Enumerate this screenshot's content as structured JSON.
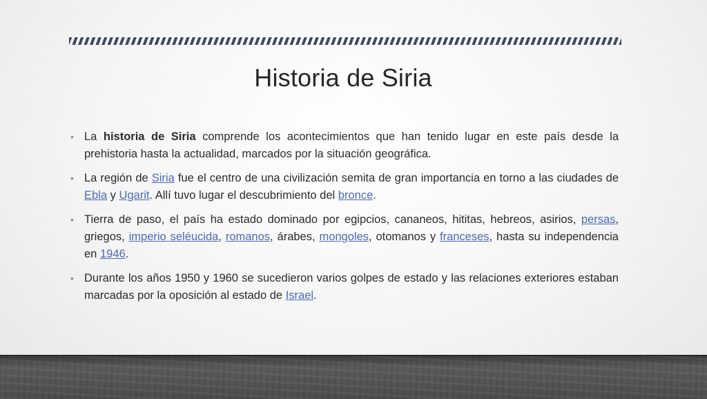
{
  "title": "Historia de Siria",
  "bullets": [
    {
      "t1": "La ",
      "b1": "historia de Siria",
      "t2": " comprende los acontecimientos que han tenido lugar en este país desde la prehistoria hasta la actualidad, marcados por la situación geográfica."
    },
    {
      "t1": "La región de ",
      "l1": "Siria",
      "t2": " fue el centro de una civilización semita de gran importancia en torno a las ciudades de ",
      "l2": "Ebla",
      "t3": " y ",
      "l3": "Ugarit",
      "t4": ". Allí tuvo lugar el descubrimiento del ",
      "l4": "bronce",
      "t5": "."
    },
    {
      "t1": "Tierra de paso, el país ha estado dominado por egipcios, cananeos, hititas, hebreos, asirios, ",
      "l1": "persas",
      "t2": ", griegos, ",
      "l2": "imperio seléucida",
      "t3": ", ",
      "l3": "romanos",
      "t4": ", árabes, ",
      "l4": "mongoles",
      "t5": ", otomanos y ",
      "l5": "franceses",
      "t6": ", hasta su independencia en ",
      "l6": "1946",
      "t7": "."
    },
    {
      "t1": "Durante los años 1950 y 1960 se sucedieron varios golpes de estado y las relaciones exteriores estaban marcadas por la oposición al estado de ",
      "l1": "Israel",
      "t2": "."
    }
  ],
  "bullet_glyph": "•",
  "colors": {
    "link": "#4a6ab8",
    "stripe": "#3c4a62",
    "text": "#2b2b2b"
  }
}
